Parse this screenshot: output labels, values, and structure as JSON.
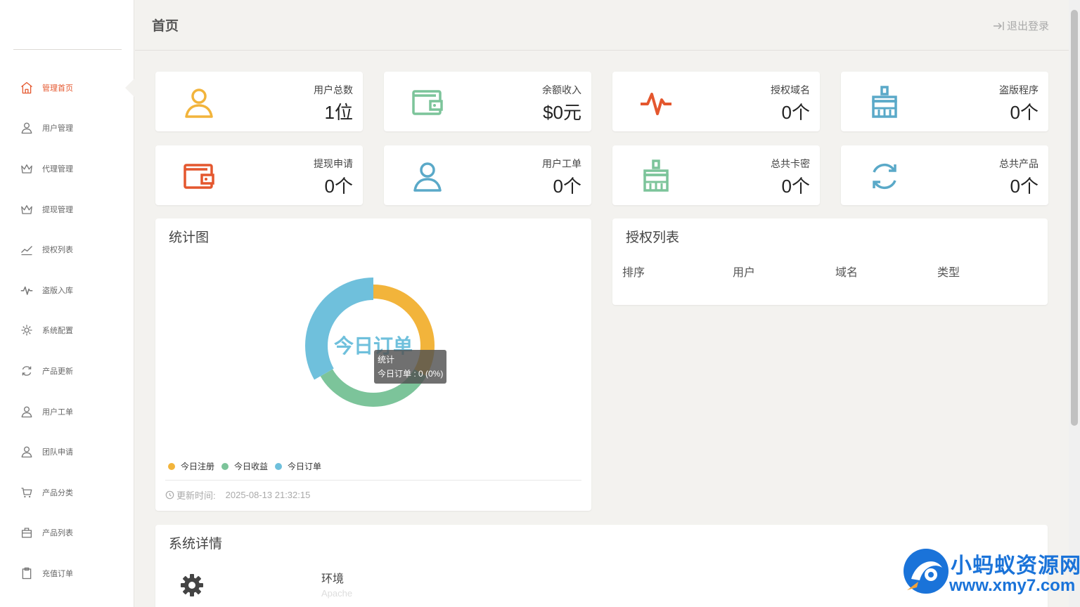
{
  "header": {
    "title": "首页",
    "logout": "退出登录"
  },
  "sidebar": {
    "items": [
      {
        "label": "管理首页",
        "icon": "home-icon",
        "active": true
      },
      {
        "label": "用户管理",
        "icon": "user-icon"
      },
      {
        "label": "代理管理",
        "icon": "crown-icon"
      },
      {
        "label": "提现管理",
        "icon": "crown-icon"
      },
      {
        "label": "授权列表",
        "icon": "trend-icon"
      },
      {
        "label": "盗版入库",
        "icon": "pulse-icon"
      },
      {
        "label": "系统配置",
        "icon": "gear-icon"
      },
      {
        "label": "产品更新",
        "icon": "refresh-icon"
      },
      {
        "label": "用户工单",
        "icon": "user-icon"
      },
      {
        "label": "团队申请",
        "icon": "user-icon"
      },
      {
        "label": "产品分类",
        "icon": "cart-icon"
      },
      {
        "label": "产品列表",
        "icon": "bag-icon"
      },
      {
        "label": "充值订单",
        "icon": "clipboard-icon"
      }
    ]
  },
  "stats": [
    {
      "label": "用户总数",
      "value": "1位",
      "icon": "user-icon",
      "color": "#f2b43b"
    },
    {
      "label": "余额收入",
      "value": "$0元",
      "icon": "wallet-icon",
      "color": "#7cc49a"
    },
    {
      "label": "授权域名",
      "value": "0个",
      "icon": "pulse-icon",
      "color": "#e4572e"
    },
    {
      "label": "盗版程序",
      "value": "0个",
      "icon": "broom-icon",
      "color": "#5aa9c8"
    },
    {
      "label": "提现申请",
      "value": "0个",
      "icon": "wallet-icon",
      "color": "#e4572e"
    },
    {
      "label": "用户工单",
      "value": "0个",
      "icon": "user-icon",
      "color": "#5aa9c8"
    },
    {
      "label": "总共卡密",
      "value": "0个",
      "icon": "broom-icon",
      "color": "#7cc49a"
    },
    {
      "label": "总共产品",
      "value": "0个",
      "icon": "refresh-icon",
      "color": "#5aa9c8"
    }
  ],
  "chart": {
    "title": "统计图",
    "center_label": "今日订单",
    "tooltip": {
      "title": "统计",
      "line": "今日订单 : 0 (0%)"
    },
    "update_label": "更新时间:",
    "update_time": "2025-08-13 21:32:15"
  },
  "chart_data": {
    "type": "pie",
    "donut": true,
    "categories": [
      "今日注册",
      "今日收益",
      "今日订单"
    ],
    "values": [
      0,
      0,
      0
    ],
    "colors": [
      "#f2b43b",
      "#7cc49a",
      "#6fc0dc"
    ],
    "highlighted": "今日订单",
    "legend": "bottom-left"
  },
  "auth_list": {
    "title": "授权列表",
    "columns": [
      "排序",
      "用户",
      "域名",
      "类型"
    ]
  },
  "system": {
    "title": "系统详情",
    "items": [
      {
        "name": "环境",
        "value": "Apache"
      }
    ]
  },
  "watermark": {
    "name": "小蚂蚁资源网",
    "url": "www.xmy7.com"
  }
}
